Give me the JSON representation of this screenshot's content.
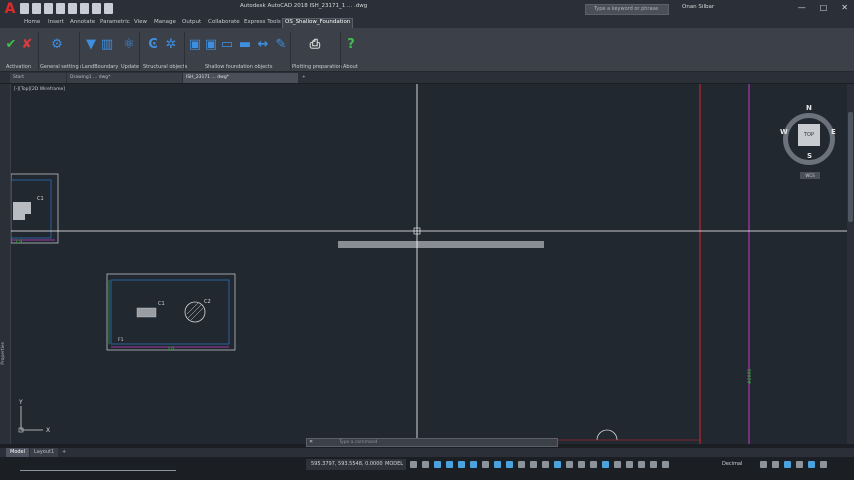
{
  "app": {
    "title": "Autodesk AutoCAD 2018   ISH_23171_1 ... .dwg",
    "logo": "A",
    "search_placeholder": "Type a keyword or phrase",
    "user": "Onan Silbar",
    "window_controls": [
      "—",
      "□",
      "✕"
    ]
  },
  "ribbon_tabs": [
    "Home",
    "Insert",
    "Annotate",
    "Parametric",
    "View",
    "Manage",
    "Output",
    "Collaborate",
    "Express Tools",
    "OS_Shallow_Foundation"
  ],
  "ribbon_groups": [
    "Activation",
    "General settings",
    "LandBoundary",
    "Update",
    "Structural objects",
    "Shallow foundation objects",
    "Plotting preparation",
    "About"
  ],
  "doc_tabs": [
    "Start",
    "Drawing1 ... dwg*",
    "ISH_23171 ... dwg*"
  ],
  "viewport_label": "[-][Top][2D Wireframe]",
  "side_panel_label": "Properties",
  "viewcube": {
    "top": "TOP",
    "north": "N",
    "south": "S",
    "east": "E",
    "west": "W",
    "wcs": "WCS"
  },
  "drawing_labels": {
    "footing_a": "C1",
    "footing_b": "C1",
    "footing_c": "C2",
    "dim_a": "1.9",
    "dim_b": "3.6",
    "dim_c": "F3",
    "dim_d": "F1",
    "vertical_line": "#2000",
    "ucs_x": "X",
    "ucs_y": "Y"
  },
  "command_line": {
    "close": "✕",
    "placeholder": "Type a command"
  },
  "layout_tabs": [
    "Model",
    "Layout1",
    "+"
  ],
  "status": {
    "coords": "595.3797, 593.5548, 0.0000",
    "model": "MODEL",
    "units": "Decimal"
  },
  "colors": {
    "background": "#212830",
    "crosshair": "#ffffff",
    "red_line": "#d6242a",
    "magenta_line": "#c83cc8",
    "footing_blue": "#2d6fb8"
  }
}
